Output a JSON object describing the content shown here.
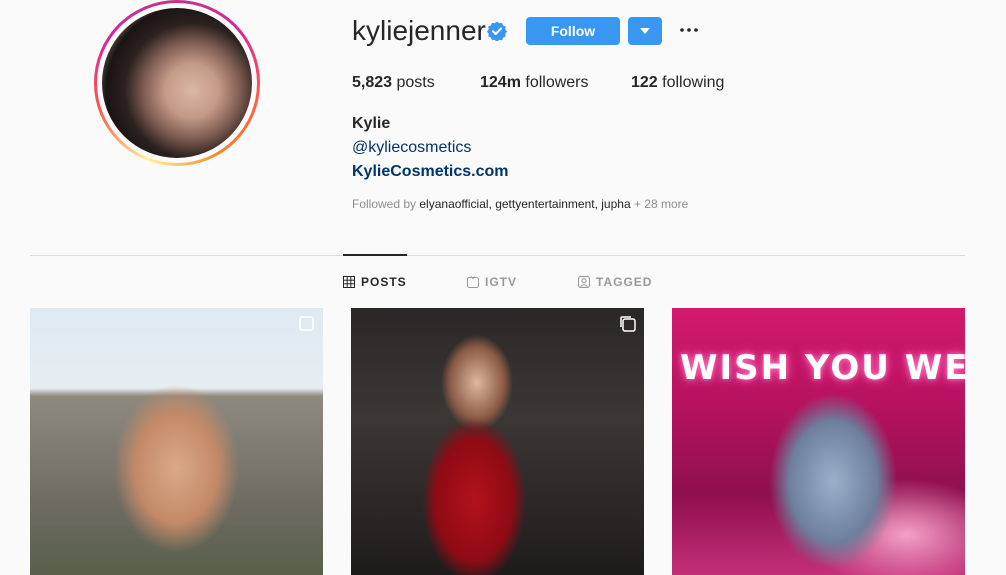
{
  "profile": {
    "username": "kyliejenner",
    "follow_label": "Follow",
    "posts_count": "5,823",
    "posts_label": "posts",
    "followers_count": "124m",
    "followers_label": "followers",
    "following_count": "122",
    "following_label": "following",
    "full_name": "Kylie",
    "bio_mention": "@kyliecosmetics",
    "website": "KylieCosmetics.com",
    "followed_by_prefix": "Followed by",
    "followed_by_names": "elyanaofficial, gettyentertainment, jupha",
    "followed_by_more": "+ 28 more"
  },
  "tabs": [
    {
      "label": "POSTS",
      "icon": "grid-icon",
      "active": true
    },
    {
      "label": "IGTV",
      "icon": "igtv-icon",
      "active": false
    },
    {
      "label": "TAGGED",
      "icon": "tagged-icon",
      "active": false
    }
  ],
  "posts": [
    {
      "description_icon": "multi-post-icon"
    },
    {
      "description_icon": "multi-post-icon"
    },
    {
      "neon_text": "WISH YOU WERE"
    }
  ],
  "colors": {
    "follow_blue": "#3897f0",
    "link_blue": "#003569",
    "verified_blue": "#3897f0",
    "muted_gray": "#8e8e8e"
  }
}
